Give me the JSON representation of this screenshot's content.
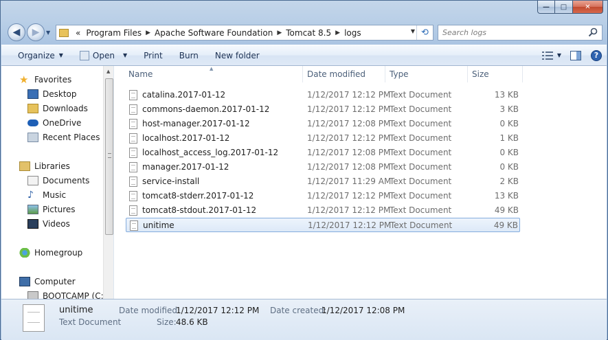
{
  "window": {
    "minimize": "—",
    "maximize": "□",
    "close": "✕"
  },
  "breadcrumb": {
    "overflow": "«",
    "items": [
      "Program Files",
      "Apache Software Foundation",
      "Tomcat 8.5",
      "logs"
    ]
  },
  "search": {
    "placeholder": "Search logs"
  },
  "toolbar": {
    "organize": "Organize",
    "open": "Open",
    "print": "Print",
    "burn": "Burn",
    "new_folder": "New folder",
    "help": "?"
  },
  "sidebar": {
    "favorites": "Favorites",
    "desktop": "Desktop",
    "downloads": "Downloads",
    "onedrive": "OneDrive",
    "recent": "Recent Places",
    "libraries": "Libraries",
    "documents": "Documents",
    "music": "Music",
    "pictures": "Pictures",
    "videos": "Videos",
    "homegroup": "Homegroup",
    "computer": "Computer",
    "bootcamp": "BOOTCAMP (C:)"
  },
  "columns": {
    "name": "Name",
    "date": "Date modified",
    "type": "Type",
    "size": "Size"
  },
  "files": [
    {
      "name": "catalina.2017-01-12",
      "date": "1/12/2017 12:12 PM",
      "type": "Text Document",
      "size": "13 KB"
    },
    {
      "name": "commons-daemon.2017-01-12",
      "date": "1/12/2017 12:12 PM",
      "type": "Text Document",
      "size": "3 KB"
    },
    {
      "name": "host-manager.2017-01-12",
      "date": "1/12/2017 12:08 PM",
      "type": "Text Document",
      "size": "0 KB"
    },
    {
      "name": "localhost.2017-01-12",
      "date": "1/12/2017 12:12 PM",
      "type": "Text Document",
      "size": "1 KB"
    },
    {
      "name": "localhost_access_log.2017-01-12",
      "date": "1/12/2017 12:08 PM",
      "type": "Text Document",
      "size": "0 KB"
    },
    {
      "name": "manager.2017-01-12",
      "date": "1/12/2017 12:08 PM",
      "type": "Text Document",
      "size": "0 KB"
    },
    {
      "name": "service-install",
      "date": "1/12/2017 11:29 AM",
      "type": "Text Document",
      "size": "2 KB"
    },
    {
      "name": "tomcat8-stderr.2017-01-12",
      "date": "1/12/2017 12:12 PM",
      "type": "Text Document",
      "size": "13 KB"
    },
    {
      "name": "tomcat8-stdout.2017-01-12",
      "date": "1/12/2017 12:12 PM",
      "type": "Text Document",
      "size": "49 KB"
    },
    {
      "name": "unitime",
      "date": "1/12/2017 12:12 PM",
      "type": "Text Document",
      "size": "49 KB"
    }
  ],
  "details": {
    "name": "unitime",
    "type": "Text Document",
    "modified_label": "Date modified:",
    "modified_value": "1/12/2017 12:12 PM",
    "created_label": "Date created:",
    "created_value": "1/12/2017 12:08 PM",
    "size_label": "Size:",
    "size_value": "48.6 KB"
  }
}
